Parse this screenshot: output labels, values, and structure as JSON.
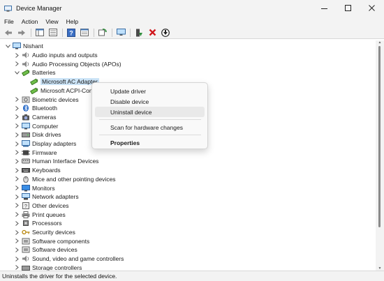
{
  "window": {
    "title": "Device Manager"
  },
  "menu": [
    "File",
    "Action",
    "View",
    "Help"
  ],
  "toolbar": {
    "buttons": [
      "back-arrow-icon",
      "forward-arrow-icon",
      "show-hide-console-tree-icon",
      "properties-icon",
      "help-icon",
      "refresh-icon",
      "computer-monitor-icon",
      "update-driver-icon",
      "uninstall-x-icon",
      "enable-device-icon"
    ]
  },
  "tree": {
    "root": "Nishant",
    "batteries": "Batteries",
    "battery_children": [
      "Microsoft AC Adapter",
      "Microsoft ACPI-Compliant Control Method Battery"
    ],
    "battery_child_visible": [
      "Microsoft AC Adapter",
      "Microsoft ACPI-Con"
    ],
    "categories_before": [
      "Audio inputs and outputs",
      "Audio Processing Objects (APOs)"
    ],
    "categories_after": [
      "Biometric devices",
      "Bluetooth",
      "Cameras",
      "Computer",
      "Disk drives",
      "Display adapters",
      "Firmware",
      "Human Interface Devices",
      "Keyboards",
      "Mice and other pointing devices",
      "Monitors",
      "Network adapters",
      "Other devices",
      "Print queues",
      "Processors",
      "Security devices",
      "Software components",
      "Software devices",
      "Sound, video and game controllers",
      "Storage controllers"
    ]
  },
  "context_menu": {
    "items": [
      "Update driver",
      "Disable device",
      "Uninstall device",
      "Scan for hardware changes",
      "Properties"
    ],
    "highlighted": "Uninstall device",
    "default": "Properties"
  },
  "status": "Uninstalls the driver for the selected device.",
  "colors": {
    "selection": "#cce4f7",
    "chrome": "#f3f3f3",
    "menu_hover": "#e9e9e9"
  }
}
